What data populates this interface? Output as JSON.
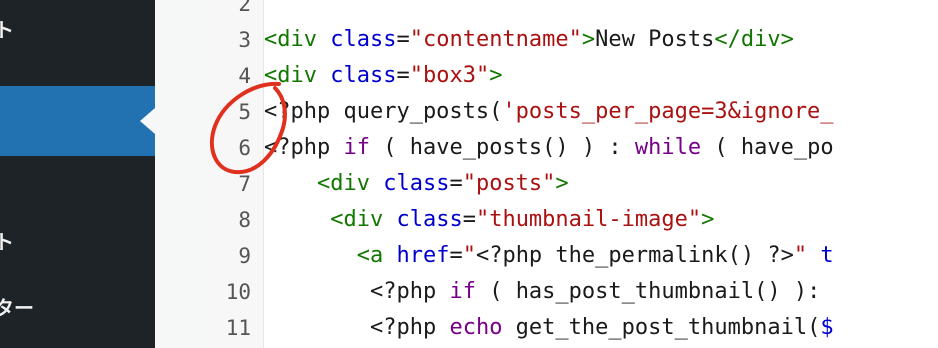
{
  "sidebar": {
    "items": [
      {
        "label": "ト"
      },
      {
        "label": ""
      },
      {
        "label": "ト"
      },
      {
        "label": "ター"
      }
    ]
  },
  "editor": {
    "lines": [
      {
        "num": "2",
        "tokens": []
      },
      {
        "num": "3",
        "tokens": [
          {
            "t": "tag",
            "v": "<div"
          },
          {
            "t": "txt",
            "v": " "
          },
          {
            "t": "attr",
            "v": "class"
          },
          {
            "t": "txt",
            "v": "="
          },
          {
            "t": "str",
            "v": "\"contentname\""
          },
          {
            "t": "tag",
            "v": ">"
          },
          {
            "t": "txt",
            "v": "New Posts"
          },
          {
            "t": "tag",
            "v": "</div>"
          }
        ]
      },
      {
        "num": "4",
        "tokens": [
          {
            "t": "tag",
            "v": "<div"
          },
          {
            "t": "txt",
            "v": " "
          },
          {
            "t": "attr",
            "v": "class"
          },
          {
            "t": "txt",
            "v": "="
          },
          {
            "t": "str",
            "v": "\"box3\""
          },
          {
            "t": "tag",
            "v": ">"
          }
        ]
      },
      {
        "num": "5",
        "tokens": [
          {
            "t": "txt",
            "v": "<?php query_posts("
          },
          {
            "t": "str",
            "v": "'posts_per_page=3&ignore_"
          }
        ]
      },
      {
        "num": "6",
        "tokens": [
          {
            "t": "txt",
            "v": "<?php "
          },
          {
            "t": "kw",
            "v": "if"
          },
          {
            "t": "txt",
            "v": " ( have_posts() ) : "
          },
          {
            "t": "kw",
            "v": "while"
          },
          {
            "t": "txt",
            "v": " ( have_po"
          }
        ]
      },
      {
        "num": "7",
        "indent": "    ",
        "tokens": [
          {
            "t": "tag",
            "v": "<div"
          },
          {
            "t": "txt",
            "v": " "
          },
          {
            "t": "attr",
            "v": "class"
          },
          {
            "t": "txt",
            "v": "="
          },
          {
            "t": "str",
            "v": "\"posts\""
          },
          {
            "t": "tag",
            "v": ">"
          }
        ]
      },
      {
        "num": "8",
        "indent": "     ",
        "tokens": [
          {
            "t": "tag",
            "v": "<div"
          },
          {
            "t": "txt",
            "v": " "
          },
          {
            "t": "attr",
            "v": "class"
          },
          {
            "t": "txt",
            "v": "="
          },
          {
            "t": "str",
            "v": "\"thumbnail-image\""
          },
          {
            "t": "tag",
            "v": ">"
          }
        ]
      },
      {
        "num": "9",
        "indent": "       ",
        "tokens": [
          {
            "t": "tag",
            "v": "<a"
          },
          {
            "t": "txt",
            "v": " "
          },
          {
            "t": "attr",
            "v": "href"
          },
          {
            "t": "txt",
            "v": "="
          },
          {
            "t": "str",
            "v": "\""
          },
          {
            "t": "txt",
            "v": "<?php the_permalink() ?>"
          },
          {
            "t": "str",
            "v": "\""
          },
          {
            "t": "txt",
            "v": " "
          },
          {
            "t": "attr",
            "v": "t"
          }
        ]
      },
      {
        "num": "10",
        "indent": "        ",
        "tokens": [
          {
            "t": "txt",
            "v": "<?php "
          },
          {
            "t": "kw",
            "v": "if"
          },
          {
            "t": "txt",
            "v": " ( has_post_thumbnail() ):"
          }
        ]
      },
      {
        "num": "11",
        "indent": "        ",
        "tokens": [
          {
            "t": "txt",
            "v": "<?php "
          },
          {
            "t": "kw",
            "v": "echo"
          },
          {
            "t": "txt",
            "v": " get_the_post_thumbnail("
          },
          {
            "t": "attr",
            "v": "$"
          }
        ]
      }
    ]
  }
}
